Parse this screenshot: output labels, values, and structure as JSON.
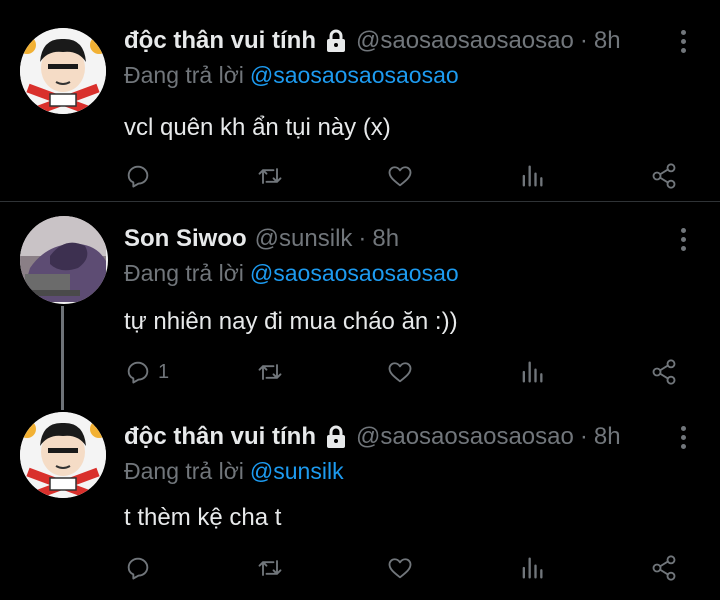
{
  "tweets": [
    {
      "name": "độc thân vui tính",
      "handle": "@saosaosaosaosao",
      "time": "8h",
      "reply_label": "Đang trả lời",
      "reply_to": "@saosaosaosaosao",
      "text": "vcl quên kh ẩn tụi này (x)",
      "reply_count": "",
      "protected": true,
      "avatar": "cartoon-face-avatar"
    },
    {
      "name": "Son Siwoo",
      "handle": "@sunsilk",
      "time": "8h",
      "reply_label": "Đang trả lời",
      "reply_to": "@saosaosaosaosao",
      "text": "tự nhiên nay đi mua cháo ăn :))",
      "reply_count": "1",
      "protected": false,
      "avatar": "photo-avatar"
    },
    {
      "name": "độc thân vui tính",
      "handle": "@saosaosaosaosao",
      "time": "8h",
      "reply_label": "Đang trả lời",
      "reply_to": "@sunsilk",
      "text": "t thèm kệ cha t",
      "reply_count": "",
      "protected": true,
      "avatar": "cartoon-face-avatar"
    }
  ],
  "dot_separator": "·",
  "icons": [
    "reply-icon",
    "retweet-icon",
    "like-icon",
    "analytics-icon",
    "share-icon",
    "more-icon",
    "lock-icon"
  ],
  "colors": {
    "background": "#000000",
    "text": "#e7e9ea",
    "muted": "#71767b",
    "link": "#1d9bf0",
    "divider": "#2f3336"
  }
}
